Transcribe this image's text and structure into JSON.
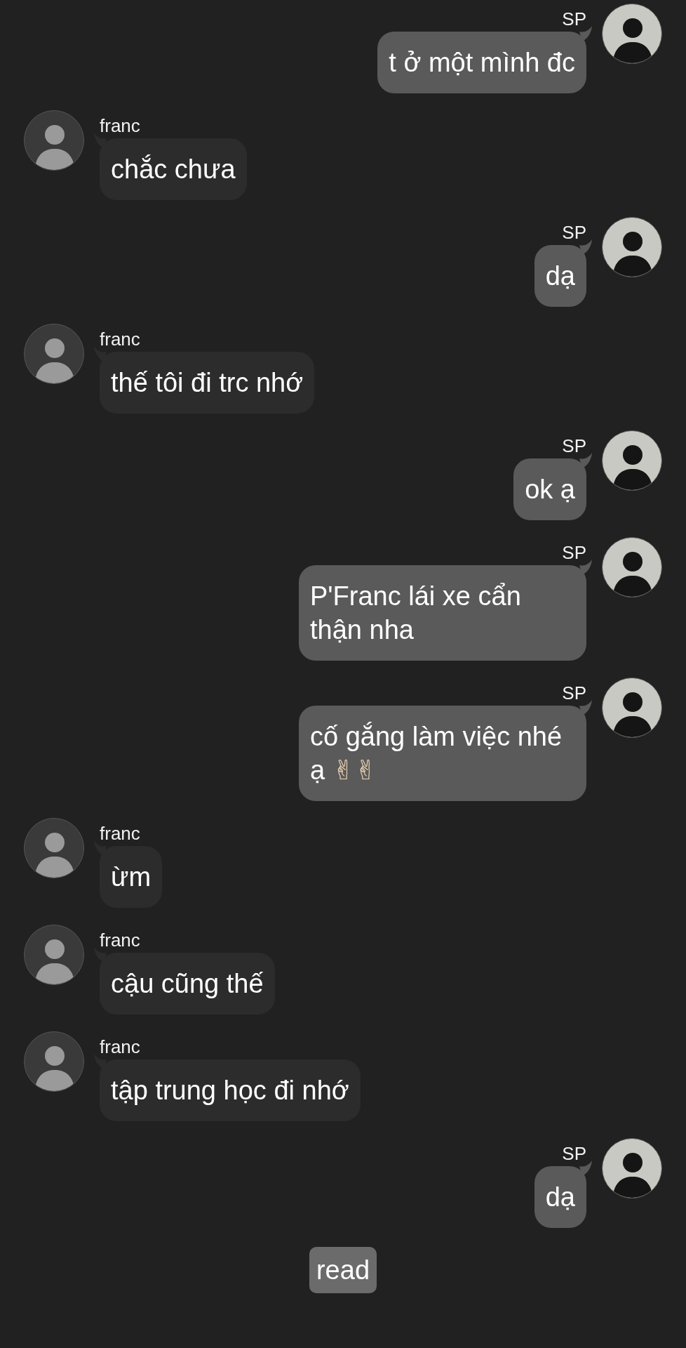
{
  "messages": [
    {
      "kind": "outgoing",
      "sender": "SP",
      "text": "t ở một mình đc"
    },
    {
      "kind": "incoming",
      "sender": "franc",
      "text": "chắc chưa"
    },
    {
      "kind": "outgoing",
      "sender": "SP",
      "text": "dạ"
    },
    {
      "kind": "incoming",
      "sender": "franc",
      "text": "thế tôi đi trc nhớ"
    },
    {
      "kind": "outgoing",
      "sender": "SP",
      "text": "ok ạ"
    },
    {
      "kind": "outgoing",
      "sender": "SP",
      "text": "P'Franc lái xe cẩn thận nha"
    },
    {
      "kind": "outgoing",
      "sender": "SP",
      "text": "cố gắng làm việc nhé ạ",
      "emoji": "✌✌"
    },
    {
      "kind": "incoming",
      "sender": "franc",
      "text": "ừm"
    },
    {
      "kind": "incoming",
      "sender": "franc",
      "text": "cậu cũng thế"
    },
    {
      "kind": "incoming",
      "sender": "franc",
      "text": "tập trung học đi nhớ"
    },
    {
      "kind": "outgoing",
      "sender": "SP",
      "text": "dạ"
    }
  ],
  "status": "read"
}
